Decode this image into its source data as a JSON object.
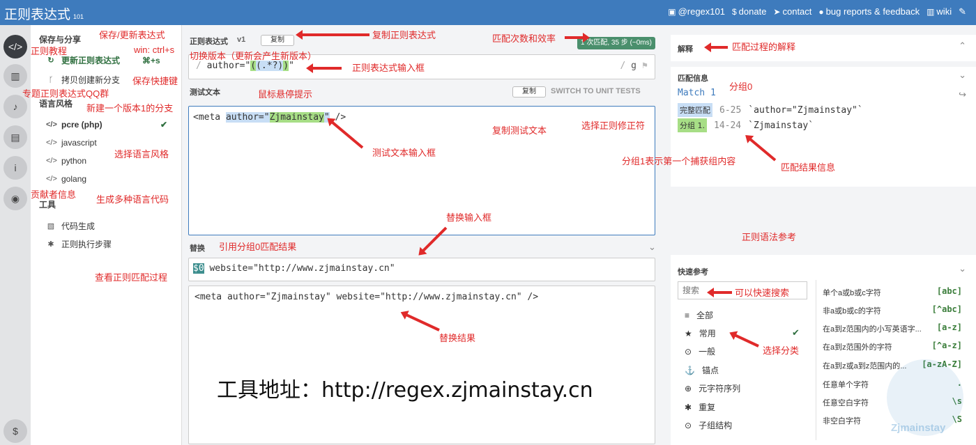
{
  "header": {
    "title": "正则表达式",
    "version": "101",
    "links": [
      {
        "icon": "twitter-icon",
        "label": "@regex101"
      },
      {
        "icon": "dollar-icon",
        "label": "donate"
      },
      {
        "icon": "paper-plane-icon",
        "label": "contact"
      },
      {
        "icon": "github-icon",
        "label": "bug reports & feedback"
      },
      {
        "icon": "bank-icon",
        "label": "wiki"
      }
    ]
  },
  "sidebar": {
    "save_title": "保存与分享",
    "save_update": "更新正则表达式",
    "save_shortcut": "⌘+s",
    "fork": "拷贝创建新分支",
    "flavor_title": "语言风格",
    "flavors": [
      "pcre (php)",
      "javascript",
      "python",
      "golang"
    ],
    "tools_title": "工具",
    "tools": [
      "代码生成",
      "正则执行步骤"
    ]
  },
  "regex": {
    "label": "正则表达式",
    "version": "v1",
    "copy": "复制",
    "match_badge": "1 次匹配, 35 步 (~0ms)",
    "delim": "/",
    "pre": "author=\"",
    "group": "(.*?)",
    "post": "\"",
    "flag": "g"
  },
  "test": {
    "label": "测试文本",
    "copy": "复制",
    "switch": "SWITCH TO UNIT TESTS",
    "pre": "<meta ",
    "m1": "author=\"",
    "m2": "Zjmainstay",
    "m3": "\"",
    "post": " />"
  },
  "subst": {
    "label": "替换",
    "token": "$0",
    "value": " website=\"http://www.zjmainstay.cn\"",
    "result": "<meta author=\"Zjmainstay\" website=\"http://www.zjmainstay.cn\" />",
    "big": "工具地址：http://regex.zjmainstay.cn"
  },
  "explain": {
    "title": "解释"
  },
  "matchinfo": {
    "title": "匹配信息",
    "match": "Match 1",
    "full_label": "完整匹配",
    "full_range": "6-25",
    "full_val": "`author=\"Zjmainstay\"`",
    "g_label": "分组 1.",
    "g_range": "14-24",
    "g_val": "`Zjmainstay`"
  },
  "quickref": {
    "title": "快速参考",
    "search_placeholder": "搜索",
    "cats": [
      "全部",
      "常用",
      "一般",
      "锚点",
      "元字符序列",
      "重复",
      "子组结构"
    ],
    "items": [
      {
        "d": "单个a或b或c字符",
        "t": "[abc]"
      },
      {
        "d": "非a或b或c的字符",
        "t": "[^abc]"
      },
      {
        "d": "在a到z范围内的小写英语字...",
        "t": "[a-z]"
      },
      {
        "d": "在a到z范围外的字符",
        "t": "[^a-z]"
      },
      {
        "d": "在a到z或a到z范围内的...",
        "t": "[a-zA-Z]"
      },
      {
        "d": "任意单个字符",
        "t": "."
      },
      {
        "d": "任意空白字符",
        "t": "\\s"
      },
      {
        "d": "非空白字符",
        "t": "\\S"
      }
    ]
  },
  "watermark": "Zjmainstay",
  "annotations": [
    "正则教程",
    "专题正则表达式QQ群",
    "贡献者信息",
    "保存/更新表达式",
    "win: ctrl+s",
    "保存快捷键",
    "新建一个版本1的分支",
    "选择语言风格",
    "生成多种语言代码",
    "查看正则匹配过程",
    "复制正则表达式",
    "切换版本（更新会产生新版本）",
    "匹配次数和效率",
    "正则表达式输入框",
    "鼠标悬停提示",
    "复制测试文本",
    "选择正则修正符",
    "测试文本输入框",
    "替换输入框",
    "引用分组0匹配结果",
    "替换结果",
    "匹配过程的解释",
    "分组0",
    "分组1表示第一个捕获组内容",
    "匹配结果信息",
    "正则语法参考",
    "可以快速搜索",
    "选择分类"
  ]
}
